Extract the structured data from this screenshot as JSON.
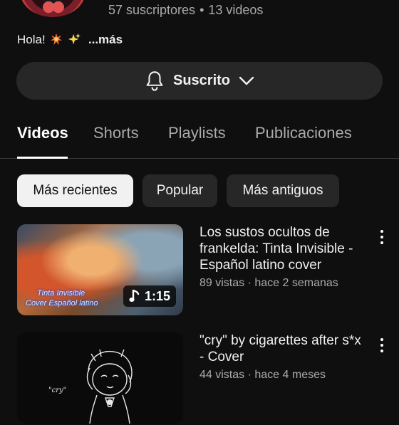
{
  "channel": {
    "subscribers": "57 suscriptores",
    "separator": "•",
    "videos_count": "13 videos",
    "description": "Hola!",
    "more": "...más"
  },
  "subscribe_button": {
    "label": "Suscrito"
  },
  "tabs": [
    {
      "label": "Videos",
      "active": true
    },
    {
      "label": "Shorts"
    },
    {
      "label": "Playlists"
    },
    {
      "label": "Publicaciones"
    }
  ],
  "chips": [
    {
      "label": "Más recientes",
      "selected": true
    },
    {
      "label": "Popular"
    },
    {
      "label": "Más antiguos"
    }
  ],
  "videos": [
    {
      "title": "Los sustos ocultos de frankelda: Tinta Invisible -Español latino cover",
      "views": "89 vistas",
      "separator": "·",
      "age": "hace 2 semanas",
      "duration": "1:15",
      "thumbnail_caption_1": "Tinta Invisible",
      "thumbnail_caption_2": "Cover  Español latino"
    },
    {
      "title": "\"cry\" by cigarettes after s*x - Cover",
      "views": "44 vistas",
      "separator": "·",
      "age": "hace 4 meses",
      "thumbnail_caption_1": "\"cry\""
    }
  ],
  "colors": {
    "background": "#0f0f0f",
    "surface": "#272727",
    "text_secondary": "#aaaaaa"
  },
  "icons": [
    "bell-icon",
    "chevron-down-icon",
    "music-note-icon",
    "more-vert-icon",
    "explosion-emoji-icon",
    "sparkles-emoji-icon"
  ]
}
